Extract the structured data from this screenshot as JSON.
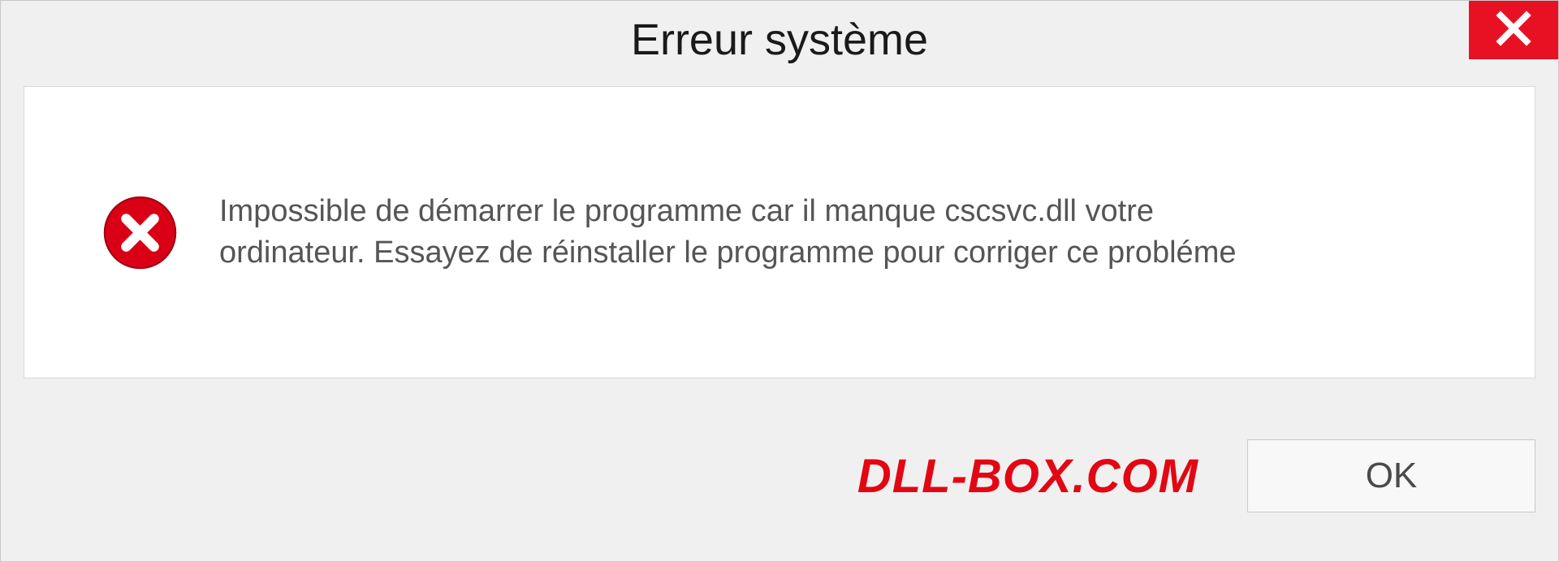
{
  "dialog": {
    "title": "Erreur système",
    "message": "Impossible de démarrer le programme car il manque cscsvc.dll votre ordinateur. Essayez de réinstaller le programme pour corriger ce probléme",
    "ok_label": "OK"
  },
  "watermark": "DLL-BOX.COM",
  "colors": {
    "close_bg": "#e81123",
    "error_icon": "#d90015",
    "watermark": "#e30613"
  }
}
